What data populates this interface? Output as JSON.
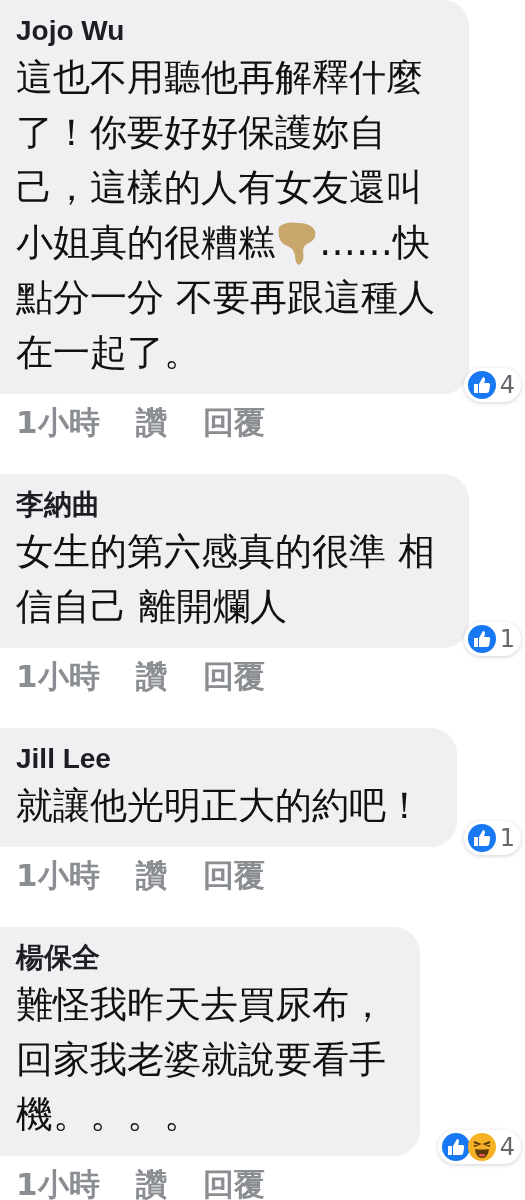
{
  "comments": [
    {
      "author": "Jojo Wu",
      "lines": [
        [
          {
            "kind": "text",
            "text": "這也不用聽他再解釋什麼"
          }
        ],
        [
          {
            "kind": "text",
            "text": "了！你要好好保護妳自"
          }
        ],
        [
          {
            "kind": "text",
            "text": "己，這樣的人有女友還叫"
          }
        ],
        [
          {
            "kind": "text",
            "text": "小姐真的很糟糕"
          },
          {
            "kind": "emoji"
          },
          {
            "kind": "text",
            "text": "……快"
          }
        ],
        [
          {
            "kind": "text",
            "text": "點分一分 不要再跟這種人"
          }
        ],
        [
          {
            "kind": "text",
            "text": "在一起了。"
          }
        ]
      ],
      "time": "1小時",
      "like": "讚",
      "reply": "回覆",
      "reactions": [
        {
          "kind": "like"
        }
      ],
      "count": "4"
    },
    {
      "author": "李納曲",
      "lines": [
        [
          {
            "kind": "text",
            "text": "女生的第六感真的很準 相"
          }
        ],
        [
          {
            "kind": "text",
            "text": "信自己 離開爛人"
          }
        ]
      ],
      "time": "1小時",
      "like": "讚",
      "reply": "回覆",
      "reactions": [
        {
          "kind": "like"
        }
      ],
      "count": "1"
    },
    {
      "author": "Jill Lee",
      "lines": [
        [
          {
            "kind": "text",
            "text": "就讓他光明正大的約吧！"
          }
        ]
      ],
      "time": "1小時",
      "like": "讚",
      "reply": "回覆",
      "reactions": [
        {
          "kind": "like"
        }
      ],
      "count": "1"
    },
    {
      "author": "楊保全",
      "lines": [
        [
          {
            "kind": "text",
            "text": "難怪我昨天去買尿布，"
          }
        ],
        [
          {
            "kind": "text",
            "text": "回家我老婆就說要看手"
          }
        ],
        [
          {
            "kind": "text",
            "text": "機。。。。"
          }
        ]
      ],
      "time": "1小時",
      "like": "讚",
      "reply": "回覆",
      "reactions": [
        {
          "kind": "like"
        },
        {
          "kind": "haha"
        }
      ],
      "count": "4"
    }
  ]
}
